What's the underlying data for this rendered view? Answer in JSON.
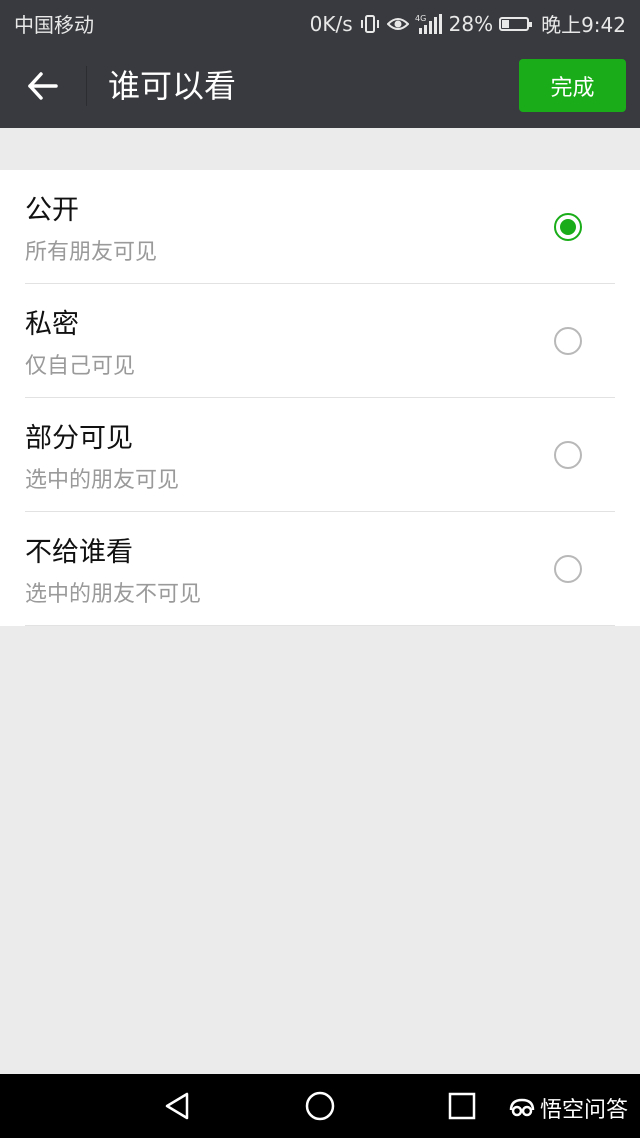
{
  "status_bar": {
    "carrier": "中国移动",
    "speed": "0K/s",
    "network": "4G",
    "battery": "28%",
    "battery_level": 0.28,
    "time": "晚上9:42"
  },
  "header": {
    "title": "谁可以看",
    "done_label": "完成"
  },
  "options": [
    {
      "title": "公开",
      "subtitle": "所有朋友可见",
      "selected": true
    },
    {
      "title": "私密",
      "subtitle": "仅自己可见",
      "selected": false
    },
    {
      "title": "部分可见",
      "subtitle": "选中的朋友可见",
      "selected": false
    },
    {
      "title": "不给谁看",
      "subtitle": "选中的朋友不可见",
      "selected": false
    }
  ],
  "watermark": {
    "text": "悟空问答"
  },
  "colors": {
    "bar": "#393a3f",
    "accent": "#1aad19",
    "background": "#ebebeb"
  }
}
